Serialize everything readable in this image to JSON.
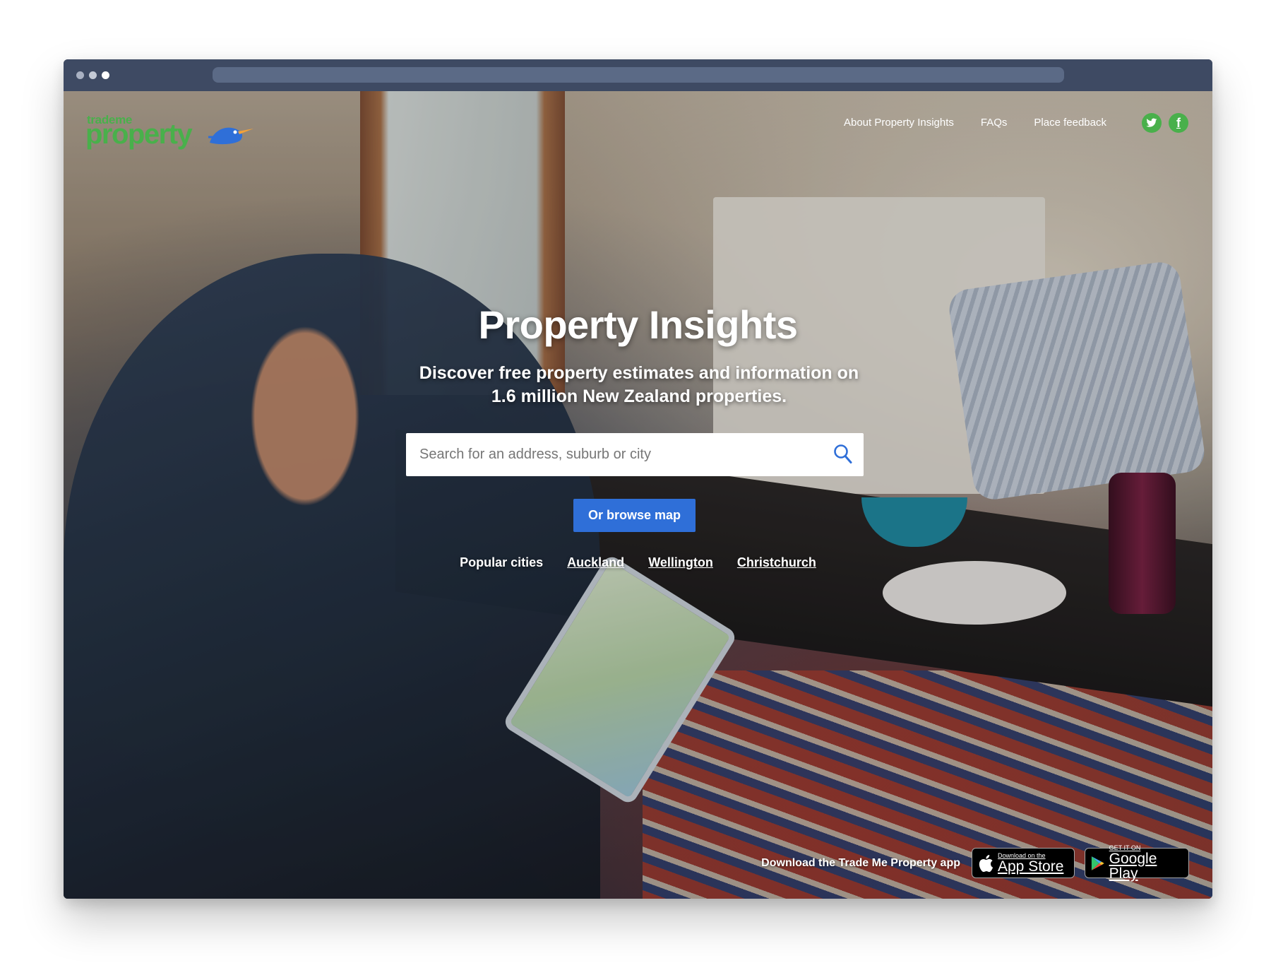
{
  "site": {
    "logo_small": "trademe",
    "logo_big": "property"
  },
  "nav": {
    "about": "About Property Insights",
    "faqs": "FAQs",
    "feedback": "Place feedback"
  },
  "hero": {
    "title": "Property Insights",
    "subtitle": "Discover free property estimates and information on 1.6 million New Zealand properties."
  },
  "search": {
    "placeholder": "Search for an address, suburb or city",
    "value": ""
  },
  "browse_button": "Or browse map",
  "popular": {
    "label": "Popular cities",
    "cities": [
      "Auckland",
      "Wellington",
      "Christchurch"
    ]
  },
  "app": {
    "label": "Download the Trade Me Property app",
    "appstore_top": "Download on the",
    "appstore_bottom": "App Store",
    "googleplay_top": "GET IT ON",
    "googleplay_bottom": "Google Play"
  },
  "colors": {
    "brand_green": "#49b04b",
    "button_blue": "#2f6fd8",
    "titlebar": "#3e4a63"
  },
  "icons": [
    "search-icon",
    "twitter-icon",
    "facebook-icon",
    "kiwi-bird-icon",
    "apple-icon",
    "google-play-icon"
  ]
}
